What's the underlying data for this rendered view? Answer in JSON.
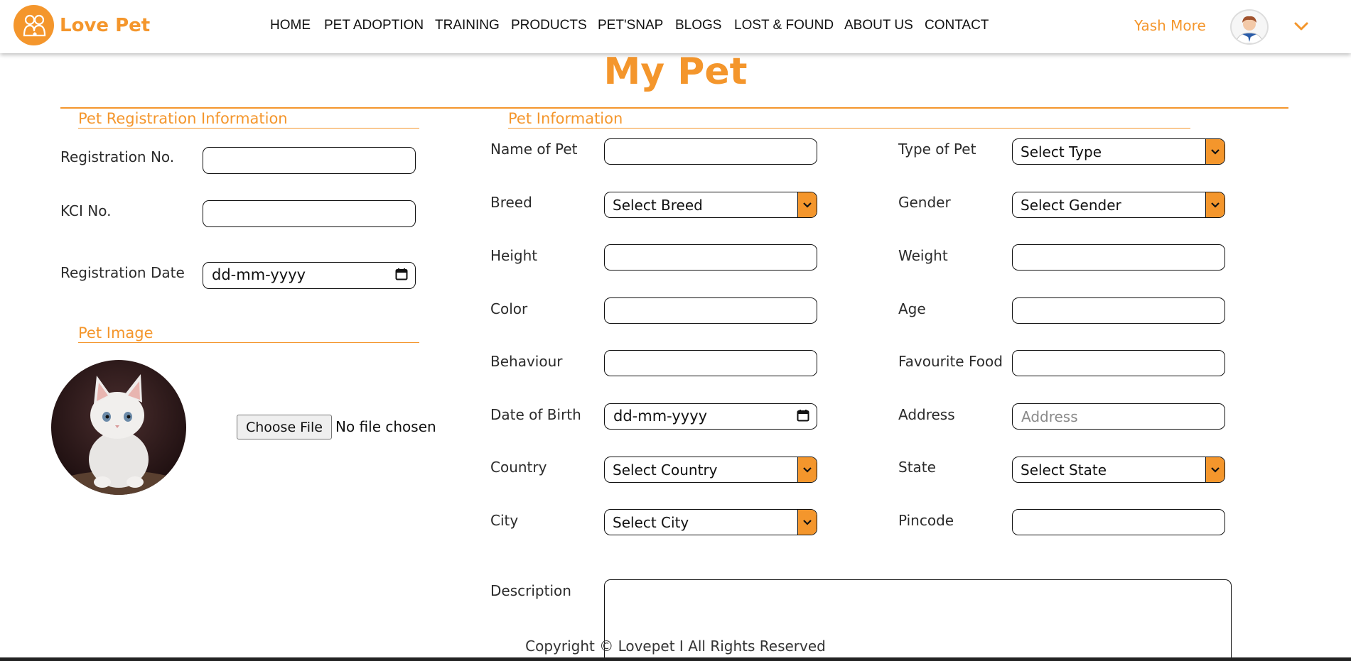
{
  "brand": {
    "name": "Love Pet",
    "color": "#f4962c"
  },
  "nav": [
    "HOME",
    "PET ADOPTION",
    "TRAINING",
    "PRODUCTS",
    "PET'SNAP",
    "BLOGS",
    "LOST & FOUND",
    "ABOUT US",
    "CONTACT"
  ],
  "user": {
    "name": "Yash More",
    "avatar_icon": "user-avatar-icon",
    "menu_icon": "chevron-down-icon"
  },
  "page": {
    "title": "My Pet"
  },
  "registration": {
    "title": "Pet Registration Information",
    "registration_no": {
      "label": "Registration No.",
      "value": ""
    },
    "kci_no": {
      "label": "KCI No.",
      "value": ""
    },
    "registration_date": {
      "label": "Registration Date",
      "value": "dd-mm-yyyy"
    }
  },
  "image": {
    "title": "Pet Image",
    "choose_label": "Choose File",
    "file_status": "No file chosen"
  },
  "info": {
    "title": "Pet Information",
    "name": {
      "label": "Name of Pet",
      "value": ""
    },
    "type": {
      "label": "Type of Pet",
      "selected": "Select Type"
    },
    "breed": {
      "label": "Breed",
      "selected": "Select Breed"
    },
    "gender": {
      "label": "Gender",
      "selected": "Select Gender"
    },
    "height": {
      "label": "Height",
      "value": ""
    },
    "weight": {
      "label": "Weight",
      "value": ""
    },
    "color": {
      "label": "Color",
      "value": ""
    },
    "age": {
      "label": "Age",
      "value": ""
    },
    "behaviour": {
      "label": "Behaviour",
      "value": ""
    },
    "food": {
      "label": "Favourite Food",
      "value": ""
    },
    "dob": {
      "label": "Date of Birth",
      "value": "dd-mm-yyyy"
    },
    "address": {
      "label": "Address",
      "placeholder": "Address"
    },
    "country": {
      "label": "Country",
      "selected": "Select Country"
    },
    "state": {
      "label": "State",
      "selected": "Select State"
    },
    "city": {
      "label": "City",
      "selected": "Select City"
    },
    "pincode": {
      "label": "Pincode",
      "value": ""
    },
    "description": {
      "label": "Description",
      "value": ""
    }
  },
  "footer": {
    "text": "Copyright © Lovepet I All Rights Reserved"
  }
}
